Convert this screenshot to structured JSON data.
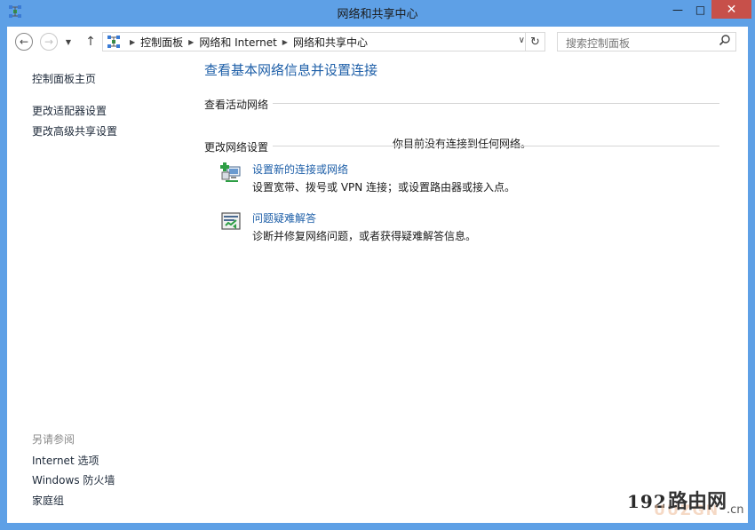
{
  "window": {
    "title": "网络和共享中心",
    "min_glyph": "—",
    "max_glyph": "□",
    "close_glyph": "✕"
  },
  "navigation": {
    "back_glyph": "←",
    "forward_glyph": "→",
    "recent_glyph": "▼",
    "up_glyph": "↑",
    "breadcrumbs": [
      "控制面板",
      "网络和 Internet",
      "网络和共享中心"
    ],
    "separator": "▶",
    "dropdown_glyph": "∨",
    "refresh_glyph": "↻"
  },
  "search": {
    "placeholder": "搜索控制面板"
  },
  "sidebar": {
    "top_links": [
      "控制面板主页",
      "更改适配器设置",
      "更改高级共享设置"
    ],
    "see_also_heading": "另请参阅",
    "see_also_links": [
      "Internet 选项",
      "Windows 防火墙",
      "家庭组"
    ]
  },
  "main": {
    "title": "查看基本网络信息并设置连接",
    "active_networks_label": "查看活动网络",
    "no_network_message": "你目前没有连接到任何网络。",
    "change_settings_label": "更改网络设置",
    "tasks": [
      {
        "icon": "network-setup-icon",
        "link": "设置新的连接或网络",
        "description": "设置宽带、拨号或 VPN 连接；或设置路由器或接入点。"
      },
      {
        "icon": "troubleshoot-icon",
        "link": "问题疑难解答",
        "description": "诊断并修复网络问题，或者获得疑难解答信息。"
      }
    ]
  },
  "watermark": {
    "number": "192",
    "text": "路由网",
    "sub": "UUZGN",
    "domain": ".cn"
  },
  "colors": {
    "frame": "#5ea0e6",
    "link": "#1e5fa8",
    "close_button": "#c7504a"
  }
}
